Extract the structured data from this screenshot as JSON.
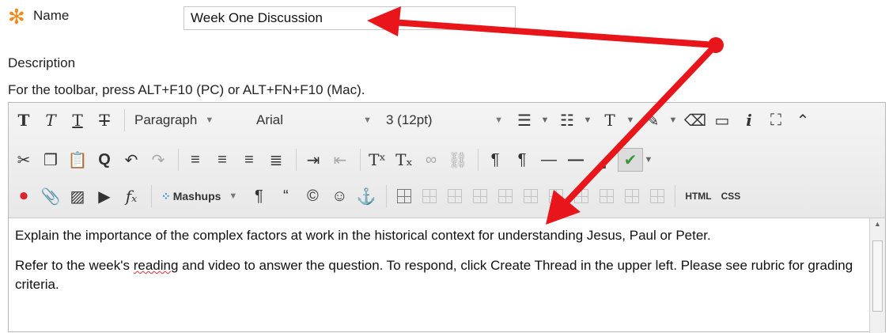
{
  "form": {
    "required_marker": "✻",
    "name_label": "Name",
    "name_value": "Week One Discussion",
    "description_label": "Description",
    "toolbar_hint": "For the toolbar, press ALT+F10 (PC) or ALT+FN+F10 (Mac)."
  },
  "toolbar": {
    "paragraph": "Paragraph",
    "font": "Arial",
    "size": "3 (12pt)",
    "mashups": "Mashups",
    "html": "HTML",
    "css": "CSS"
  },
  "editor_content": {
    "paragraph1": "Explain the importance of the complex factors at work in the historical context for understanding Jesus, Paul or Peter.",
    "p2_before": "Refer to the week's ",
    "p2_misspelled": "reading",
    "p2_after": " and video to answer the question.  To respond, click Create Thread in the upper left.  Please see rubric for grading criteria."
  },
  "colors": {
    "required": "#f08a1c",
    "annotation_arrow": "#e8161b"
  }
}
